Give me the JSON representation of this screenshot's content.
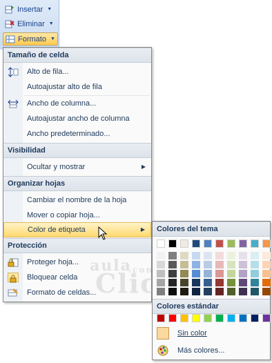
{
  "ribbon": {
    "insert_label": "Insertar",
    "delete_label": "Eliminar",
    "format_label": "Formato"
  },
  "menu": {
    "sections": {
      "cell_size": "Tamaño de celda",
      "visibility": "Visibilidad",
      "organize": "Organizar hojas",
      "protection": "Protección"
    },
    "items": {
      "row_height": "Alto de fila...",
      "autofit_row": "Autoajustar alto de fila",
      "column_width": "Ancho de columna...",
      "autofit_column": "Autoajustar ancho de columna",
      "default_width": "Ancho predeterminado...",
      "hide_unhide": "Ocultar y mostrar",
      "rename_sheet": "Cambiar el nombre de la hoja",
      "move_copy": "Mover o copiar hoja...",
      "tab_color": "Color de etiqueta",
      "protect_sheet": "Proteger hoja...",
      "lock_cell": "Bloquear celda",
      "format_cells": "Formato de celdas..."
    }
  },
  "color_menu": {
    "theme_header": "Colores del tema",
    "standard_header": "Colores estándar",
    "no_color": "Sin color",
    "more_colors": "Más colores...",
    "theme_top": [
      "#ffffff",
      "#000000",
      "#eeece1",
      "#1f497d",
      "#4f81bd",
      "#c0504d",
      "#9bbb59",
      "#8064a2",
      "#4bacc6",
      "#f79646"
    ],
    "theme_shades": [
      [
        "#f2f2f2",
        "#d8d8d8",
        "#bfbfbf",
        "#a5a5a5",
        "#7f7f7f"
      ],
      [
        "#7f7f7f",
        "#595959",
        "#3f3f3f",
        "#262626",
        "#0c0c0c"
      ],
      [
        "#ddd9c3",
        "#c4bd97",
        "#938953",
        "#494429",
        "#1d1b10"
      ],
      [
        "#c6d9f0",
        "#8db3e2",
        "#548dd4",
        "#17365d",
        "#0f243e"
      ],
      [
        "#dbe5f1",
        "#b8cce4",
        "#95b3d7",
        "#366092",
        "#244061"
      ],
      [
        "#f2dcdb",
        "#e5b9b7",
        "#d99694",
        "#953734",
        "#632423"
      ],
      [
        "#ebf1dd",
        "#d7e3bc",
        "#c3d69b",
        "#76923c",
        "#4f6128"
      ],
      [
        "#e5e0ec",
        "#ccc1d9",
        "#b2a2c7",
        "#5f497a",
        "#3f3151"
      ],
      [
        "#dbeef3",
        "#b7dde8",
        "#92cddc",
        "#31859b",
        "#205867"
      ],
      [
        "#fdeada",
        "#fbd5b5",
        "#fac08f",
        "#e36c09",
        "#974806"
      ]
    ],
    "standard": [
      "#c00000",
      "#ff0000",
      "#ffc000",
      "#ffff00",
      "#92d050",
      "#00b050",
      "#00b0f0",
      "#0070c0",
      "#002060",
      "#7030a0"
    ],
    "no_color_swatch": "#fbd8a0"
  },
  "watermark": {
    "word": "aula",
    "word2": "Clic",
    "suffix": ".com"
  }
}
